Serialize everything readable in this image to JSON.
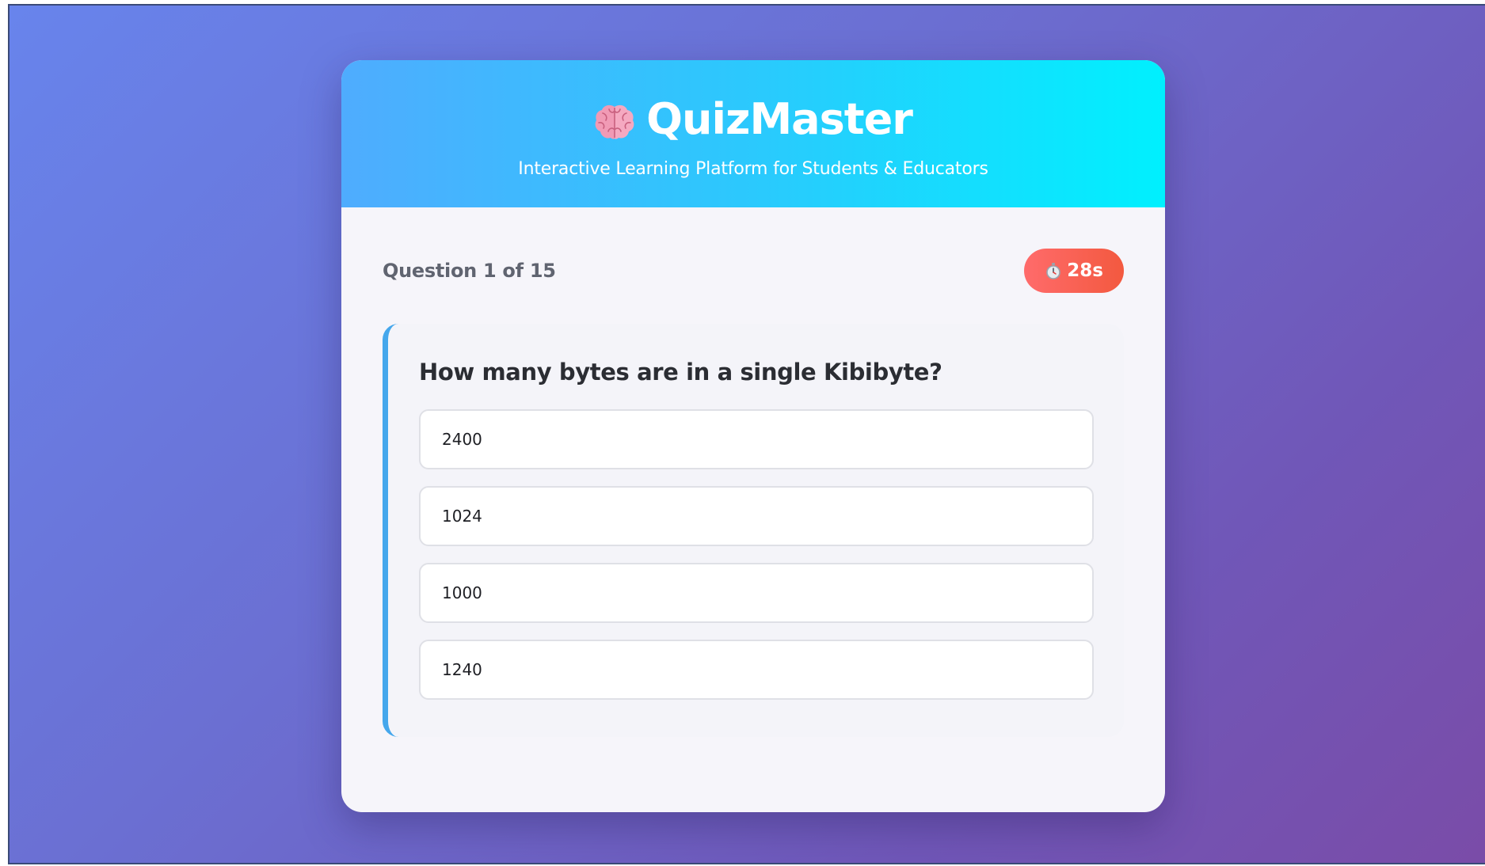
{
  "header": {
    "title": "QuizMaster",
    "subtitle": "Interactive Learning Platform for Students & Educators",
    "logo_icon": "brain-icon"
  },
  "progress": {
    "label": "Question 1 of 15",
    "current": 1,
    "total": 15
  },
  "timer": {
    "icon": "stopwatch-icon",
    "value": "28s"
  },
  "question": {
    "text": "How many bytes are in a single Kibibyte?",
    "options": [
      "2400",
      "1024",
      "1000",
      "1240"
    ]
  },
  "colors": {
    "header_gradient_start": "#4facfe",
    "header_gradient_end": "#00f2fe",
    "timer_gradient_start": "#ff6b6b",
    "timer_gradient_end": "#f3593f",
    "question_accent": "#45a7ec",
    "background_start": "#667eea",
    "background_end": "#764ba2"
  }
}
